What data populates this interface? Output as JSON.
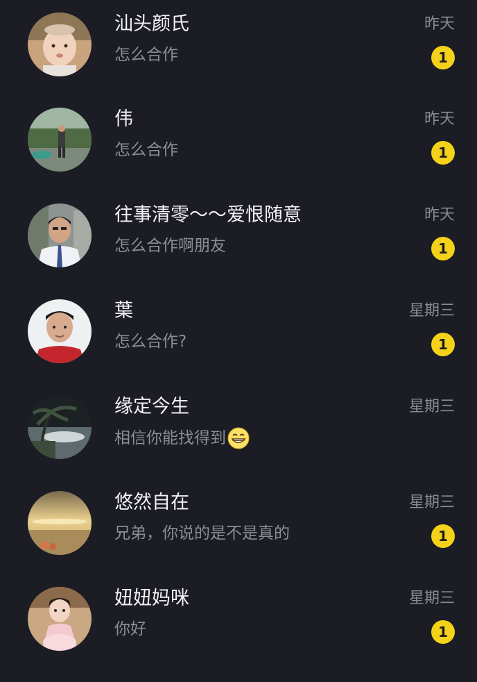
{
  "colors": {
    "background": "#1b1c24",
    "name_text": "#f2f2f4",
    "secondary_text": "#8c8d95",
    "badge": "#f5d21a"
  },
  "chats": [
    {
      "name": "汕头颜氏",
      "preview": "怎么合作",
      "time": "昨天",
      "unread": "1"
    },
    {
      "name": "伟",
      "preview": "怎么合作",
      "time": "昨天",
      "unread": "1"
    },
    {
      "name": "往事清零～～爱恨随意",
      "preview": "怎么合作啊朋友",
      "time": "昨天",
      "unread": "1"
    },
    {
      "name": "葉",
      "preview": "怎么合作?",
      "time": "星期三",
      "unread": "1"
    },
    {
      "name": "缘定今生",
      "preview": "相信你能找得到",
      "preview_emoji": "grinning-face-emoji",
      "time": "星期三"
    },
    {
      "name": "悠然自在",
      "preview": "兄弟，你说的是不是真的",
      "time": "星期三",
      "unread": "1"
    },
    {
      "name": "妞妞妈咪",
      "preview": "你好",
      "time": "星期三",
      "unread": "1"
    }
  ]
}
